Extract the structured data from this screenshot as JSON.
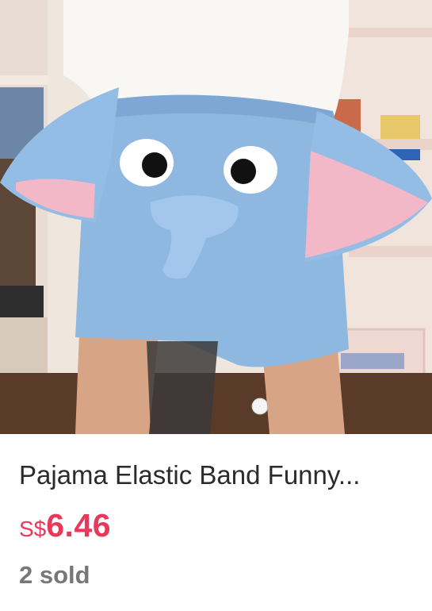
{
  "product": {
    "image_subject": "elephant-pajama-shorts",
    "title": "Pajama Elastic Band Funny...",
    "price_currency": "S$",
    "price_amount": "6.46",
    "sold_text": "2 sold"
  },
  "colors": {
    "price": "#e8395a",
    "title": "#2b2b2b",
    "sold": "#777777",
    "shorts_blue": "#8fb8e0",
    "ear_pink": "#f3b8c8"
  }
}
